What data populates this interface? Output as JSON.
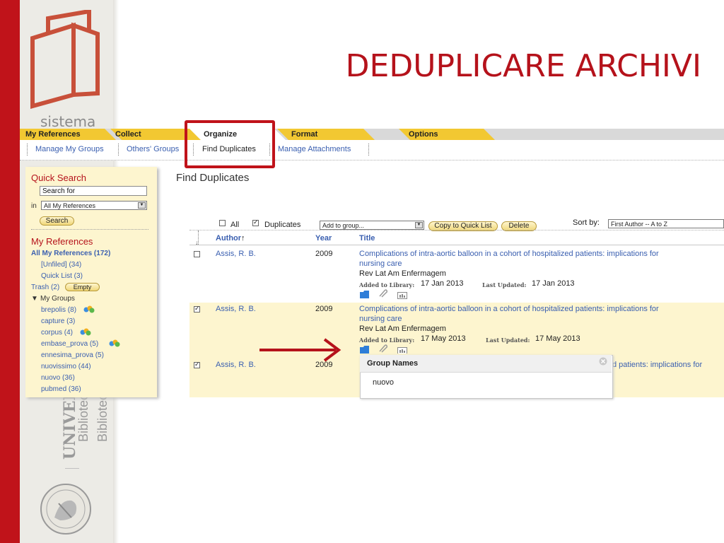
{
  "slide": {
    "title": "DEDUPLICARE ARCHIVI",
    "logo_label": "sistema",
    "univ_text": "UNIVERSI",
    "bib_text_1": "Bibliotec",
    "bib_text_2": "Bibliotec",
    "accent_color": "#b5121b"
  },
  "tabs": [
    {
      "label": "My References"
    },
    {
      "label": "Collect"
    },
    {
      "label": "Organize"
    },
    {
      "label": "Format"
    },
    {
      "label": "Options"
    }
  ],
  "subnav": [
    {
      "label": "Manage My Groups"
    },
    {
      "label": "Others' Groups"
    },
    {
      "label": "Find Duplicates"
    },
    {
      "label": "Manage Attachments"
    }
  ],
  "sidebar": {
    "quick_search_title": "Quick Search",
    "search_value": "Search for",
    "in_label": "in",
    "in_select": "All My References",
    "search_button": "Search",
    "my_refs_title": "My References",
    "all_refs": "All My References (172)",
    "unfiled": "[Unfiled] (34)",
    "quick_list": "Quick List (3)",
    "trash": "Trash (2)",
    "empty_button": "Empty",
    "my_groups": "My Groups",
    "groups": [
      {
        "label": "brepolis (8)",
        "shared": true
      },
      {
        "label": "capture (3)",
        "shared": false
      },
      {
        "label": "corpus (4)",
        "shared": true
      },
      {
        "label": "embase_prova (5)",
        "shared": true
      },
      {
        "label": "ennesima_prova (5)",
        "shared": false
      },
      {
        "label": "nuovissimo (44)",
        "shared": false
      },
      {
        "label": "nuovo (36)",
        "shared": false
      },
      {
        "label": "pubmed (36)",
        "shared": false
      }
    ]
  },
  "main": {
    "title": "Find Duplicates",
    "all_label": "All",
    "duplicates_label": "Duplicates",
    "add_to_group": "Add to group...",
    "copy_button": "Copy to Quick List",
    "delete_button": "Delete",
    "sort_label": "Sort by:",
    "sort_value": "First Author -- A to Z",
    "col_author": "Author",
    "col_year": "Year",
    "col_title": "Title",
    "added_label": "Added to Library:",
    "updated_label": "Last Updated:",
    "rows": [
      {
        "checked": false,
        "author": "Assis, R. B.",
        "year": "2009",
        "title_1": "Complications of intra-aortic balloon in a cohort of hospitalized patients: implications for",
        "title_2": "nursing care",
        "journal": "Rev Lat Am Enfermagem",
        "added": "17 Jan 2013",
        "updated": "17 Jan 2013"
      },
      {
        "checked": true,
        "author": "Assis, R. B.",
        "year": "2009",
        "title_1": "Complications of intra-aortic balloon in a cohort of hospitalized patients: implications for",
        "title_2": "nursing care",
        "journal": "Rev Lat Am Enfermagem",
        "added": "17 May 2013",
        "updated": "17 May 2013"
      },
      {
        "checked": true,
        "author": "Assis, R. B.",
        "year": "2009",
        "title_tail": "d patients: implications for"
      }
    ]
  },
  "popup": {
    "title": "Group Names",
    "item": "nuovo"
  }
}
